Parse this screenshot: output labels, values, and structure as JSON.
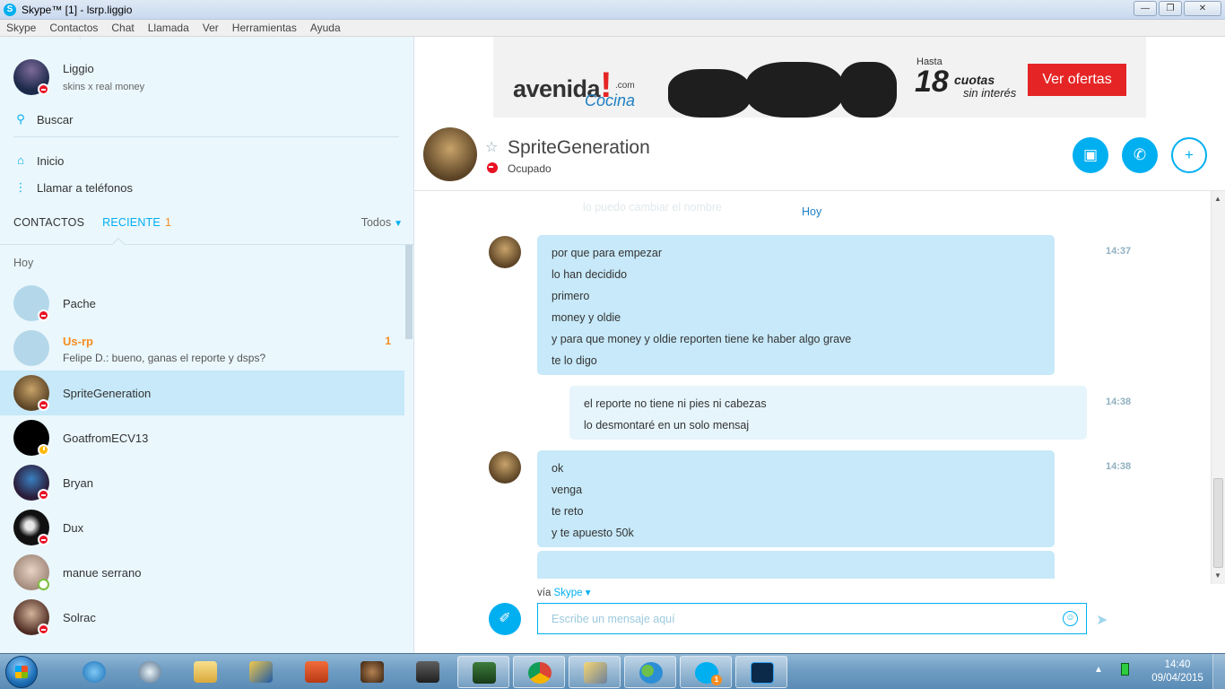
{
  "window": {
    "title": "Skype™ [1] - lsrp.liggio",
    "logo_letter": "S",
    "minimize": "—",
    "maximize": "❐",
    "close": "✕"
  },
  "menu": [
    "Skype",
    "Contactos",
    "Chat",
    "Llamada",
    "Ver",
    "Herramientas",
    "Ayuda"
  ],
  "profile": {
    "name": "Liggio",
    "mood": "skins x real money"
  },
  "nav": {
    "search": "Buscar",
    "home": "Inicio",
    "call_phones": "Llamar a teléfonos"
  },
  "tabs": {
    "contacts": "CONTACTOS",
    "recent": "RECIENTE",
    "recent_count": "1",
    "filter": "Todos"
  },
  "list_header": "Hoy",
  "contacts": [
    {
      "name": "Pache",
      "status": "busy"
    },
    {
      "name": "Us-rp",
      "sub": "Felipe D.: bueno, ganas el reporte y dsps?",
      "count": "1",
      "group": true
    },
    {
      "name": "SpriteGeneration",
      "status": "busy",
      "selected": true
    },
    {
      "name": "GoatfromECV13",
      "status": "away"
    },
    {
      "name": "Bryan",
      "status": "busy"
    },
    {
      "name": "Dux",
      "status": "busy"
    },
    {
      "name": "manue serrano",
      "status": "online"
    },
    {
      "name": "Solrac",
      "status": "busy"
    }
  ],
  "ad": {
    "brand": "avenida",
    "exclamation": "!",
    "dotcom": ".com",
    "category": "Cocina",
    "hasta": "Hasta",
    "number": "18",
    "cuotas": "cuotas",
    "sin_interes": "sin interés",
    "cta": "Ver ofertas"
  },
  "chat": {
    "name": "SpriteGeneration",
    "status": "Ocupado",
    "faded_text": "lo puedo cambiar el nombre",
    "day": "Hoy",
    "messages": [
      {
        "dir": "in",
        "lines": [
          "por que para empezar",
          "lo han decidido",
          "primero",
          "money y oldie",
          "y para que money y oldie reporten tiene ke haber algo grave",
          "te lo digo"
        ],
        "time": "14:37"
      },
      {
        "dir": "out",
        "lines": [
          "el reporte no tiene ni pies ni cabezas",
          "lo desmontaré en un solo mensaj"
        ],
        "time": "14:38"
      },
      {
        "dir": "in",
        "lines": [
          "ok",
          "venga",
          "te reto",
          "y te apuesto 50k"
        ],
        "time": "14:38"
      }
    ]
  },
  "compose": {
    "via": "vía",
    "via_link": "Skype",
    "placeholder": "Escribe un mensaje aquí"
  },
  "taskbar": {
    "clock_time": "14:40",
    "clock_date": "09/04/2015",
    "skype_badge": "1"
  },
  "colors": {
    "accent": "#00aff0",
    "busy": "#e81123",
    "unread": "#f68d1f",
    "bubble_in": "#c7e9f9",
    "bubble_out": "#e6f5fc"
  }
}
